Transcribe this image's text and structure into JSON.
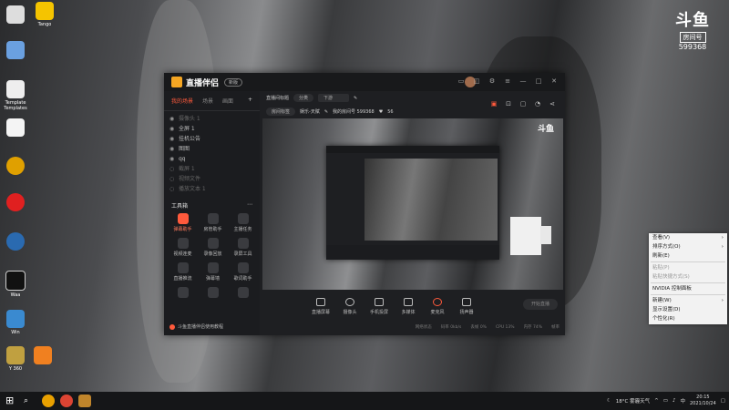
{
  "desktop": {
    "icons": [
      "Tango",
      "",
      "Template Templates",
      "",
      "",
      "",
      "",
      "",
      "Waa",
      "Win",
      "Y 360",
      ""
    ],
    "watermark": {
      "logo": "斗鱼",
      "tag": "房间号",
      "room": "599368"
    }
  },
  "app": {
    "brand": "直播伴侣",
    "version": "新版",
    "left_tabs": [
      "我的场景",
      "场景",
      "画面"
    ],
    "scenes": [
      {
        "label": "摄像头 1",
        "on": false
      },
      {
        "label": "全屏 1",
        "on": true
      },
      {
        "label": "挂机公告",
        "on": true
      },
      {
        "label": "图图",
        "on": true
      },
      {
        "label": "qq",
        "on": true
      },
      {
        "label": "截屏 1",
        "on": false
      },
      {
        "label": "视频文件",
        "on": false
      },
      {
        "label": "播放文本 1",
        "on": false
      }
    ],
    "toolbox_title": "工具箱",
    "tools": [
      "弹幕助手",
      "房管助手",
      "主播任务",
      "视频连麦",
      "录像回放",
      "录屏工具",
      "直播推流",
      "弹幕墙",
      "歌词助手",
      "",
      "",
      ""
    ],
    "bottom_note": "斗鱼直播伴侣使用教程",
    "info": {
      "title_label": "直播间标题",
      "category_label": "分类",
      "category_value": "下游",
      "room_label": "房间标签",
      "room_value": "娱乐-天赋",
      "roomid_text": "我的房间号 599368",
      "fans": "56"
    },
    "controls": [
      "直播屏幕",
      "摄像头",
      "手机投屏",
      "多媒体",
      "麦克风",
      "扬声器"
    ],
    "start_button": "开始直播",
    "status": [
      "网络状态",
      "码率 0kb/s",
      "丢帧 0%",
      "CPU 13%",
      "内存 74%",
      "帧率"
    ]
  },
  "context_menu": [
    {
      "label": "查看(V)",
      "sub": true
    },
    {
      "label": "排序方式(O)",
      "sub": true
    },
    {
      "label": "刷新(E)",
      "sub": false
    },
    {
      "label": "粘贴(P)",
      "sub": false,
      "disabled": true
    },
    {
      "label": "粘贴快捷方式(S)",
      "sub": false,
      "disabled": true
    },
    {
      "label": "NVIDIA 控制面板",
      "sub": false
    },
    {
      "label": "新建(W)",
      "sub": true
    },
    {
      "label": "显示设置(D)",
      "sub": false
    },
    {
      "label": "个性化(R)",
      "sub": false
    }
  ],
  "taskbar": {
    "weather": "18°C 雾霾天气",
    "time": "20:15",
    "date": "2021/10/24"
  }
}
